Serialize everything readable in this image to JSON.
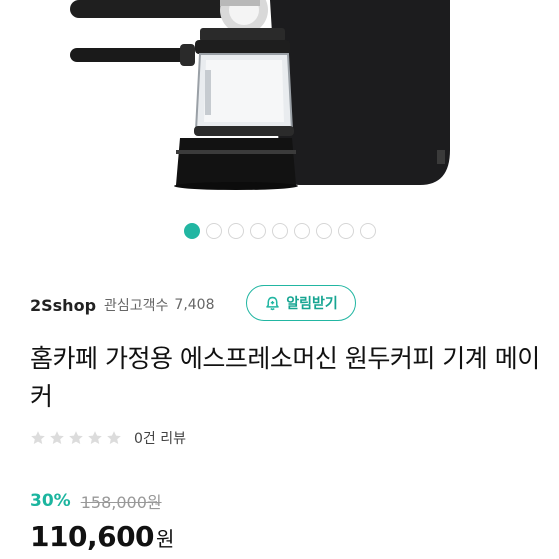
{
  "product_image": {
    "alt": "espresso-machine-photo"
  },
  "carousel": {
    "total": 9,
    "active_index": 0
  },
  "seller": {
    "name": "2Sshop",
    "favorite_label": "관심고객수",
    "favorite_count": "7,408",
    "alert_button_label": "알림받기",
    "alert_icon": "bell-plus-icon"
  },
  "product": {
    "title": "홈카페 가정용 에스프레소머신 원두커피 기계 메이커"
  },
  "rating": {
    "stars_filled": 0,
    "stars_total": 5,
    "review_text": "0건 리뷰"
  },
  "price": {
    "discount": "30%",
    "original": "158,000원",
    "final_amount": "110,600",
    "final_unit": "원"
  },
  "colors": {
    "accent": "#22b6a2",
    "discount": "#1cb59f"
  }
}
